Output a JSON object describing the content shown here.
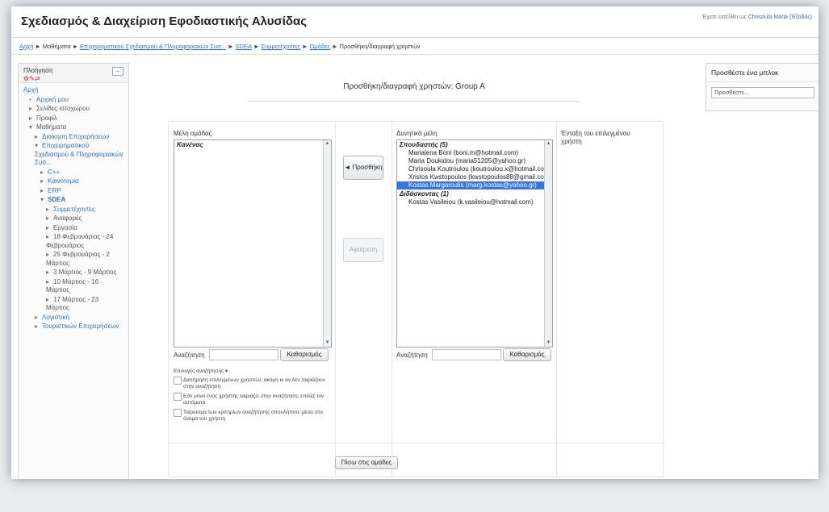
{
  "header": {
    "title": "Σχεδιασμός & Διαχείριση Εφοδιαστικής Αλυσίδας",
    "login_prefix": "Έχετε εισέλθει ως",
    "login_user": "Chrisoula Maria (Έξοδος)"
  },
  "breadcrumb": [
    {
      "label": "Αρχή",
      "link": true
    },
    {
      "label": "Μαθήματα",
      "link": false
    },
    {
      "label": "Επιχειρηματικού Σχεδιασμού & Πληροφοριακών Συσ...",
      "link": true
    },
    {
      "label": "SDEA",
      "link": true
    },
    {
      "label": "Συμμετέχοντες",
      "link": true
    },
    {
      "label": "Ομάδες",
      "link": true
    },
    {
      "label": "Προσθήκη/διαγραφή χρηστών",
      "link": false
    }
  ],
  "navigation": {
    "title": "Πλοήγηση",
    "items": [
      {
        "label": "Αρχή",
        "level": 0,
        "type": "link",
        "arrow": ""
      },
      {
        "label": "Αρχική μου",
        "level": 1,
        "type": "link",
        "arrow": "•"
      },
      {
        "label": "Σελίδες ιστοχώρου",
        "level": 1,
        "type": "plain",
        "arrow": "▸"
      },
      {
        "label": "Προφίλ",
        "level": 1,
        "type": "plain",
        "arrow": "▸"
      },
      {
        "label": "Μαθήματα",
        "level": 1,
        "type": "plain",
        "arrow": "▾"
      },
      {
        "label": "Διοίκηση Επιχειρήσεων",
        "level": 2,
        "type": "link",
        "arrow": "▸"
      },
      {
        "label": "Επιχειρηματικού Σχεδιασμού & Πληροφοριακών Συσ...",
        "level": 2,
        "type": "link",
        "arrow": "▾"
      },
      {
        "label": "C++",
        "level": 3,
        "type": "link",
        "arrow": "▸"
      },
      {
        "label": "Καινοτομία",
        "level": 3,
        "type": "link",
        "arrow": "▸"
      },
      {
        "label": "ERP",
        "level": 3,
        "type": "link",
        "arrow": "▸"
      },
      {
        "label": "SDEA",
        "level": 3,
        "type": "bold",
        "arrow": "▾"
      },
      {
        "label": "Συμμετέχοντες",
        "level": 4,
        "type": "link",
        "arrow": "▸"
      },
      {
        "label": "Αναφορές",
        "level": 4,
        "type": "plain",
        "arrow": "▸"
      },
      {
        "label": "Εργασία",
        "level": 4,
        "type": "plain",
        "arrow": "▸"
      },
      {
        "label": "18 Φεβρουάριος - 24 Φεβρουάριος",
        "level": 4,
        "type": "plain",
        "arrow": "▸"
      },
      {
        "label": "25 Φεβρουάριος - 2 Μάρτιος",
        "level": 4,
        "type": "plain",
        "arrow": "▸"
      },
      {
        "label": "3 Μάρτιος - 9 Μάρτιος",
        "level": 4,
        "type": "plain",
        "arrow": "▸"
      },
      {
        "label": "10 Μάρτιος - 16 Μάρτιος",
        "level": 4,
        "type": "plain",
        "arrow": "▸"
      },
      {
        "label": "17 Μάρτιος - 23 Μάρτιος",
        "level": 4,
        "type": "plain",
        "arrow": "▸"
      },
      {
        "label": "Λογιστική",
        "level": 2,
        "type": "link",
        "arrow": "▸"
      },
      {
        "label": "Τουριστικών Επιχειρήσεων",
        "level": 2,
        "type": "link",
        "arrow": "▸"
      }
    ]
  },
  "main": {
    "heading": "Προσθήκη/διαγραφή χρηστών: Group A",
    "members_label": "Μέλη ομάδας",
    "members_empty": "Κανένας",
    "potential_label": "Δυνητικά μέλη",
    "potential_groups": [
      {
        "title": "Σπουδαστής (5)",
        "options": [
          {
            "label": "Marialena Boni (boni.m@hotmail.com)",
            "selected": false
          },
          {
            "label": "Maria Doukidou (maria51205@yahoo.gr)",
            "selected": false
          },
          {
            "label": "Chrisoula Koutroulou (koutroulou.x@hotmail.com)",
            "selected": false
          },
          {
            "label": "Xristos Kwstopoulos (kwstopoulos88@gmail.com)",
            "selected": false
          },
          {
            "label": "Kostas Margaroulis (marg.kostas@yahoo.gr)",
            "selected": true
          }
        ]
      },
      {
        "title": "Διδάσκοντας (1)",
        "options": [
          {
            "label": "Kostas Vasileiou (k.vasileiou@hotmail.com)",
            "selected": false
          }
        ]
      }
    ],
    "add_button": "◄ Προσθήκη",
    "remove_button": "Αφαίρεση",
    "search_label": "Αναζήτηση",
    "clear_button": "Καθαρισμός",
    "search_options_label": "Επιλογές αναζήτησης ▾",
    "option1": "Διατήρηση επιλεγμένων χρηστών, ακόμη κι αν δεν ταιριάζουν στην αναζήτηση",
    "option2": "Εάν μόνο ένας χρήστης ταιριάζει στην αναζήτηση, επιλέξ τον αυτόματα",
    "option3": "Ταίριασμα των κριτηρίων αναζήτησης οπουδήποτε μέσα στο όνομα του χρήστη",
    "info_text": "Ένταξη του επιλεγμένου χρήστη",
    "back_button": "Πίσω στις ομάδες"
  },
  "add_block": {
    "title": "Προσθέστε ένα μπλοκ",
    "select_placeholder": "Προσθέστε..."
  }
}
